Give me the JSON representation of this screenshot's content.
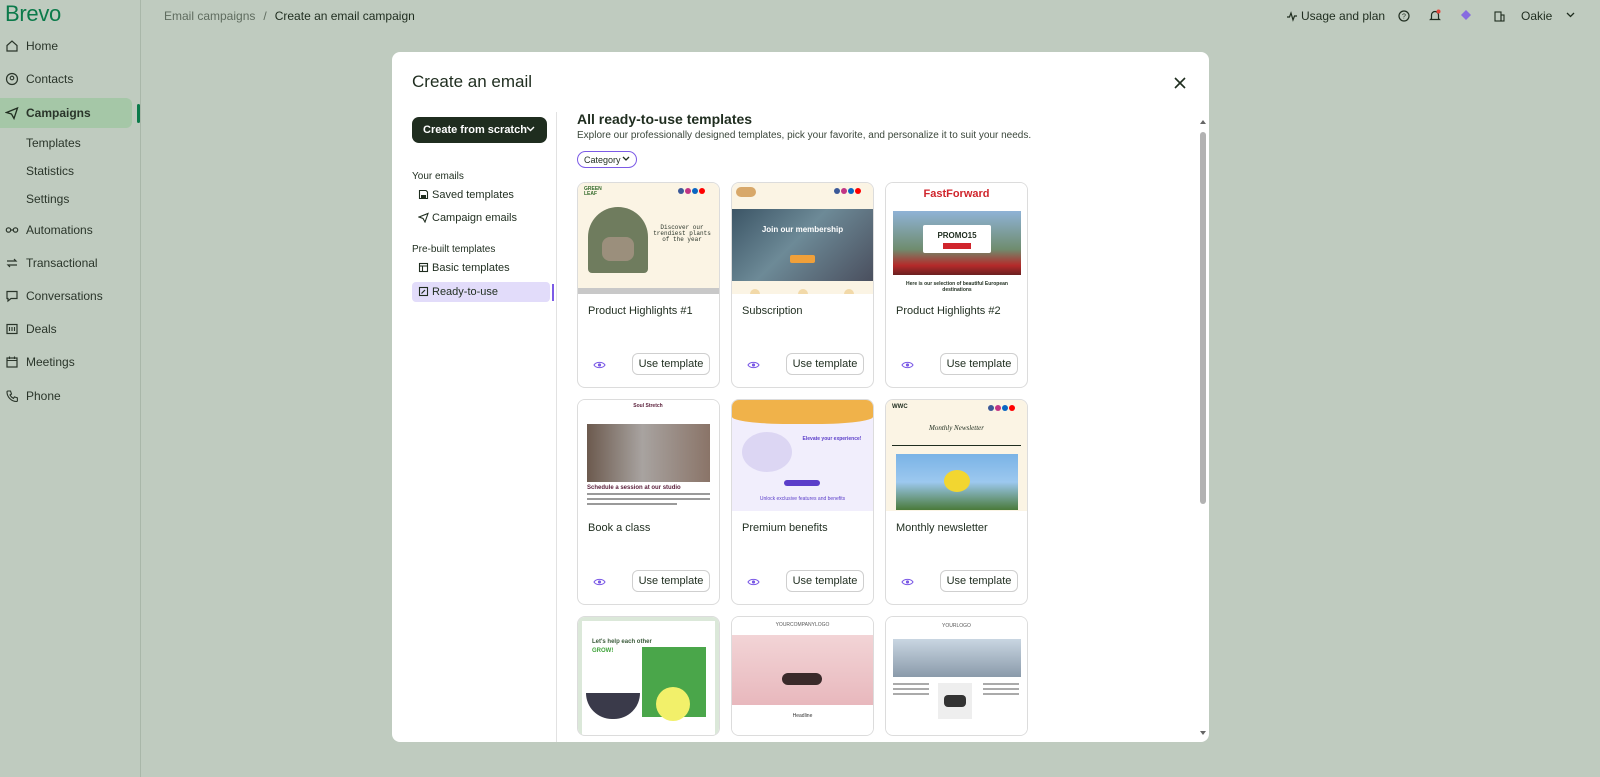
{
  "app": {
    "brand": "Brevo"
  },
  "sidebar": {
    "items": [
      {
        "label": "Home",
        "icon": "home-icon"
      },
      {
        "label": "Contacts",
        "icon": "contacts-icon"
      },
      {
        "label": "Campaigns",
        "icon": "send-icon",
        "active": true
      },
      {
        "label": "Automations",
        "icon": "automation-icon"
      },
      {
        "label": "Transactional",
        "icon": "transactional-icon"
      },
      {
        "label": "Conversations",
        "icon": "chat-icon"
      },
      {
        "label": "Deals",
        "icon": "deals-icon"
      },
      {
        "label": "Meetings",
        "icon": "calendar-icon"
      },
      {
        "label": "Phone",
        "icon": "phone-icon"
      }
    ],
    "sub_items": [
      {
        "label": "Templates"
      },
      {
        "label": "Statistics"
      },
      {
        "label": "Settings"
      }
    ]
  },
  "breadcrumb": {
    "parent": "Email campaigns",
    "separator": "/",
    "current": "Create an email campaign"
  },
  "topbar": {
    "usage_label": "Usage and plan",
    "user_name": "Oakie"
  },
  "modal": {
    "title": "Create an email",
    "scratch_button": "Create from scratch",
    "your_emails_heading": "Your emails",
    "saved_templates": "Saved templates",
    "campaign_emails": "Campaign emails",
    "prebuilt_heading": "Pre-built templates",
    "basic_templates": "Basic templates",
    "ready_to_use": "Ready-to-use",
    "content_title": "All ready-to-use templates",
    "content_subtitle": "Explore our professionally designed templates, pick your favorite, and personalize it to suit your needs.",
    "category_filter": "Category",
    "use_template_label": "Use template"
  },
  "templates": [
    {
      "name": "Product Highlights #1",
      "thumb_text_1": "Discover our trendiest plants of the year",
      "thumb_brand": "GREEN LEAF"
    },
    {
      "name": "Subscription",
      "thumb_text_1": "Join our membership"
    },
    {
      "name": "Product Highlights #2",
      "thumb_brand": "FastForward",
      "thumb_text_1": "PROMO15",
      "thumb_text_2": "Here is our selection of beautiful European destinations"
    },
    {
      "name": "Book a class",
      "thumb_brand": "Soul Stretch",
      "thumb_text_1": "Schedule a session at our studio"
    },
    {
      "name": "Premium benefits",
      "thumb_text_1": "Elevate your experience!",
      "thumb_text_2": "Unlock exclusive features and benefits"
    },
    {
      "name": "Monthly newsletter",
      "thumb_brand": "WWC",
      "thumb_text_1": "Monthly Newsletter"
    },
    {
      "name": "",
      "thumb_text_1": "Let's help each other",
      "thumb_text_2": "GROW!"
    },
    {
      "name": "",
      "thumb_brand": "YOURCOMPANYLOGO",
      "thumb_text_1": "Headline"
    },
    {
      "name": "",
      "thumb_brand": "YOURLOGO"
    }
  ],
  "colors": {
    "accent": "#7c5be6",
    "brand": "#0b7a4a",
    "sidebar_active": "#a5c7a7",
    "backdrop": "#bfcbbf"
  }
}
